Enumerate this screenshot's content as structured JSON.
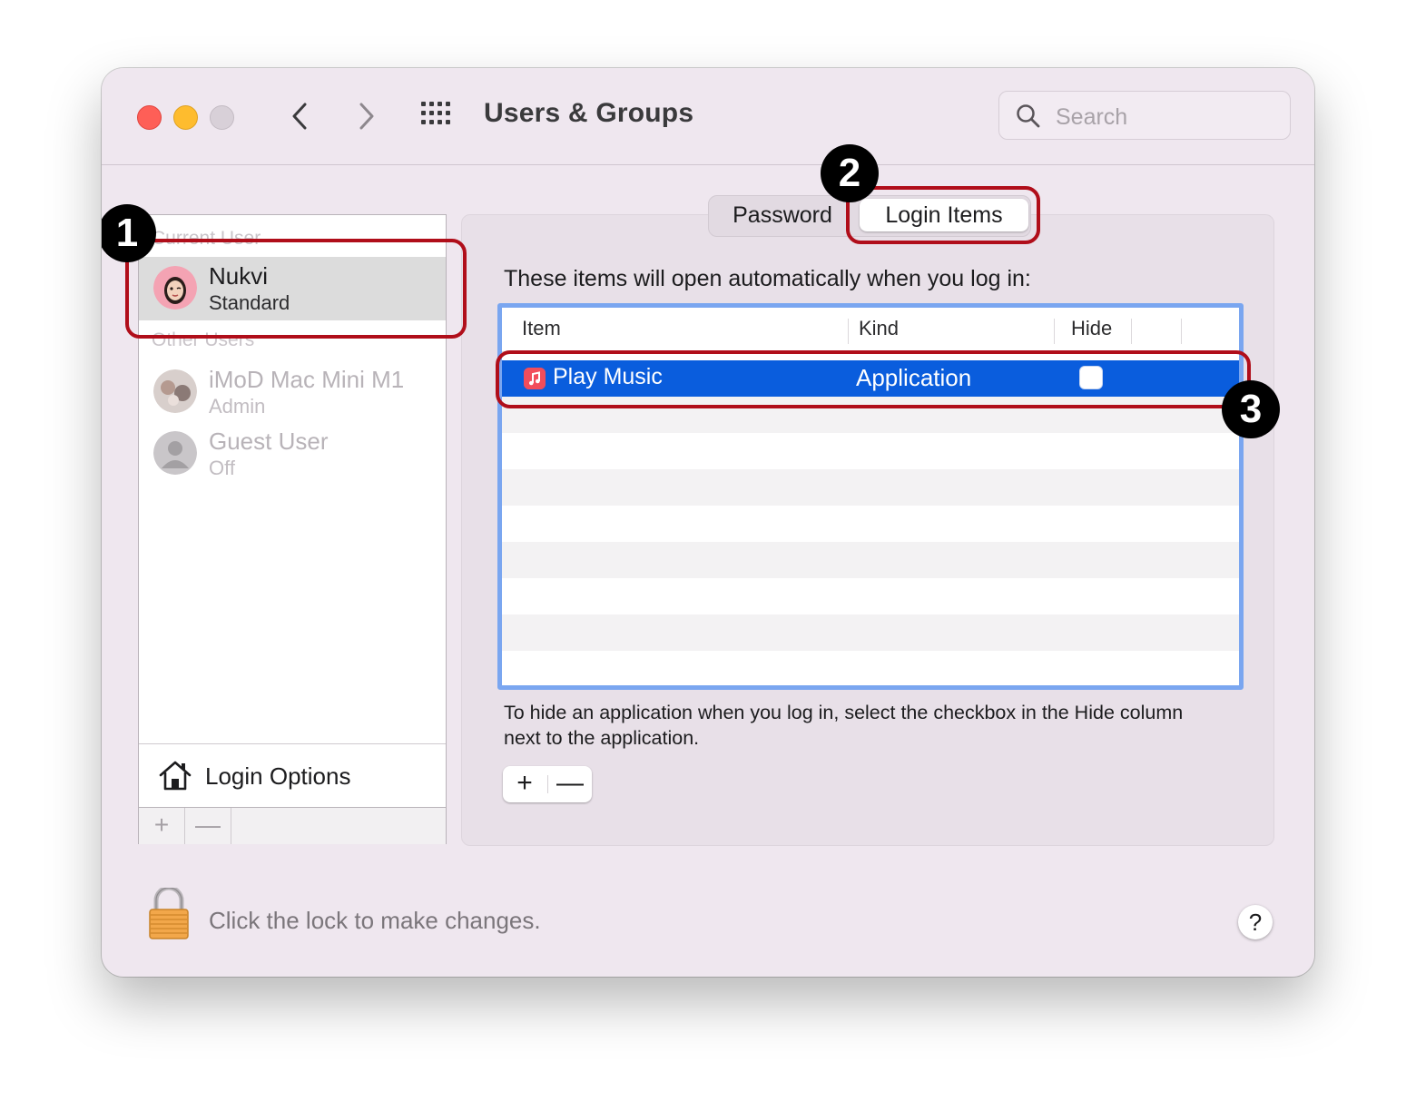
{
  "window": {
    "title": "Users & Groups",
    "search_placeholder": "Search"
  },
  "sidebar": {
    "current_user_label": "Current User",
    "other_users_label": "Other Users",
    "users": [
      {
        "name": "Nukvi",
        "role": "Standard",
        "selected": true
      },
      {
        "name": "iMoD Mac Mini M1",
        "role": "Admin",
        "selected": false
      },
      {
        "name": "Guest User",
        "role": "Off",
        "selected": false
      }
    ],
    "login_options_label": "Login Options",
    "add_label": "+",
    "remove_label": "—"
  },
  "tabs": [
    {
      "label": "Password",
      "active": false
    },
    {
      "label": "Login Items",
      "active": true
    }
  ],
  "login_items": {
    "intro": "These items will open automatically when you log in:",
    "columns": [
      "Item",
      "Kind",
      "Hide"
    ],
    "rows": [
      {
        "item": "Play Music",
        "kind": "Application",
        "hide": false,
        "selected": true
      }
    ],
    "hint": "To hide an application when you log in, select the checkbox in the Hide column next to the application.",
    "add_label": "+",
    "remove_label": "—"
  },
  "footer": {
    "lock_text": "Click the lock to make changes.",
    "help_label": "?"
  },
  "annotations": [
    "1",
    "2",
    "3"
  ],
  "colors": {
    "selection_blue": "#0a5ddd",
    "table_focus_ring": "#7aa6f0",
    "annotation_red": "#b00e1a",
    "window_bg": "#efe7ef"
  },
  "icons": [
    "back-chevron-icon",
    "forward-chevron-icon",
    "grid-icon",
    "search-icon",
    "avatar-icon",
    "house-icon",
    "music-app-icon",
    "lock-icon",
    "help-icon"
  ]
}
